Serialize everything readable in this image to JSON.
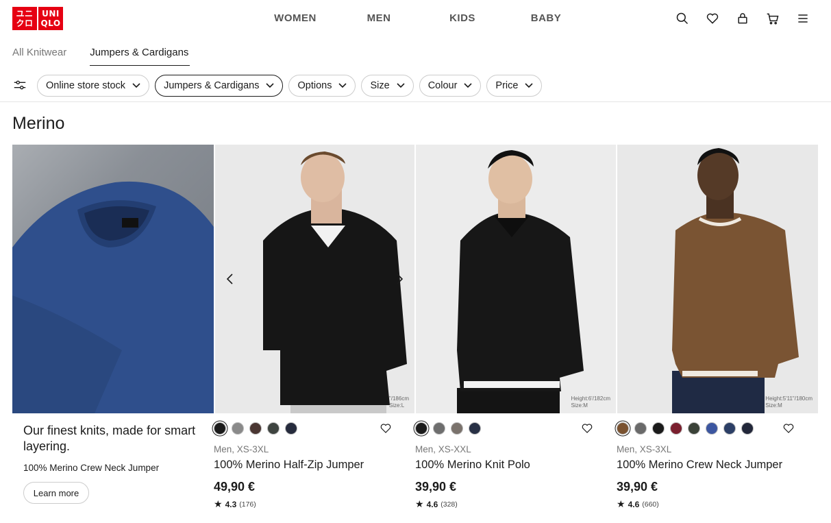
{
  "logo": {
    "line1": "ユニ",
    "line2": "クロ",
    "line3": "UNI",
    "line4": "QLO"
  },
  "nav": [
    "WOMEN",
    "MEN",
    "KIDS",
    "BABY"
  ],
  "header_icons": [
    "search-icon",
    "heart-icon",
    "account-icon",
    "cart-icon",
    "menu-icon"
  ],
  "subtabs": {
    "all": "All Knitwear",
    "active": "Jumpers & Cardigans"
  },
  "filters": [
    "Online store stock",
    "Jumpers & Cardigans",
    "Options",
    "Size",
    "Colour",
    "Price"
  ],
  "section_title": "Merino",
  "promo": {
    "headline": "Our finest knits, made for smart layering.",
    "sub": "100% Merino Crew Neck Jumper",
    "button": "Learn more"
  },
  "products": [
    {
      "image_note_1": "\"/186cm",
      "image_note_2": "Size:L",
      "swatches": [
        "#1b1b1b",
        "#8a8a8a",
        "#4a3632",
        "#3e4440",
        "#262b3d"
      ],
      "meta": "Men, XS-3XL",
      "name": "100% Merino Half-Zip Jumper",
      "price": "49,90 €",
      "score": "4.3",
      "count": "(176)"
    },
    {
      "image_note_1": "Height:6'/182cm",
      "image_note_2": "Size:M",
      "swatches": [
        "#1b1b1b",
        "#6e6e6e",
        "#7a726c",
        "#283045"
      ],
      "meta": "Men, XS-XXL",
      "name": "100% Merino Knit Polo",
      "price": "39,90 €",
      "score": "4.6",
      "count": "(328)"
    },
    {
      "image_note_1": "Height:5'11\"/180cm",
      "image_note_2": "Size:M",
      "swatches": [
        "#7a5230",
        "#6a6a6a",
        "#1b1b1b",
        "#7a1f2e",
        "#3a4238",
        "#3c56a0",
        "#2c3f66",
        "#22273a"
      ],
      "meta": "Men, XS-3XL",
      "name": "100% Merino Crew Neck Jumper",
      "price": "39,90 €",
      "score": "4.6",
      "count": "(660)"
    }
  ]
}
